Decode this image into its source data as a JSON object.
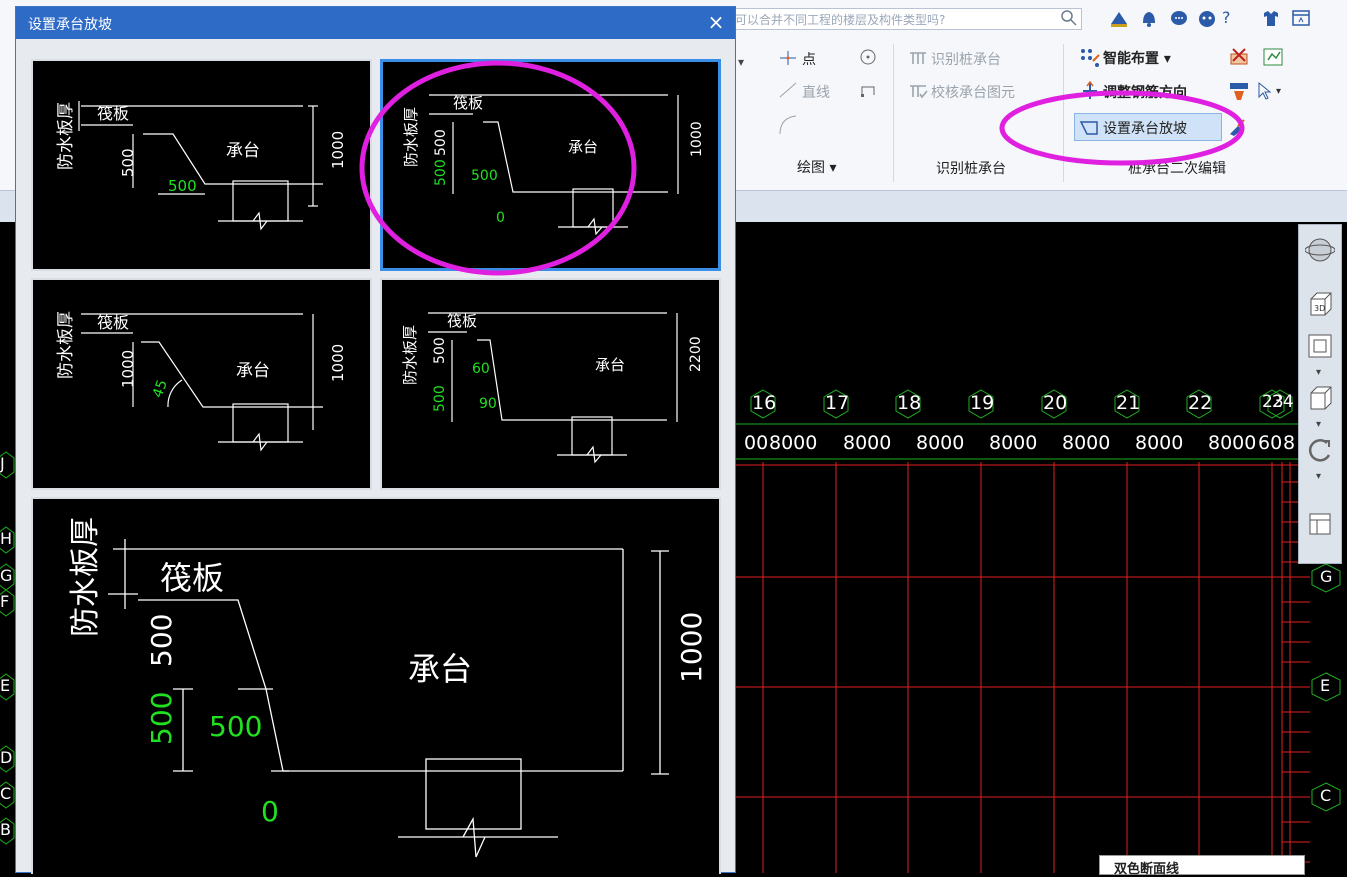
{
  "dialog": {
    "title": "设置承台放坡",
    "close_glyph": "×"
  },
  "search": {
    "text": "可以合并不同工程的楼层及构件类型吗?"
  },
  "ribbon": {
    "draw": {
      "point": "点",
      "line": "直线",
      "group_label": "绘图"
    },
    "identify": {
      "identify_pile_cap": "识别桩承台",
      "verify_pile_cap": "校核承台图元",
      "group_label": "识别桩承台"
    },
    "edit": {
      "smart_layout": "智能布置",
      "adjust_rebar_direction": "调整钢筋方向",
      "set_slope": "设置承台放坡",
      "group_label": "桩承台二次编辑"
    },
    "question": "?"
  },
  "diagrams": {
    "raft": "筏板",
    "cap": "承台",
    "waterproof": "防水板厚",
    "d1": {
      "dim_left": "500",
      "dim_bottom": "500",
      "dim_right": "1000"
    },
    "d2": {
      "dim_left_top": "500",
      "dim_left_bottom": "500",
      "dim_mid": "500",
      "dim_zero": "0",
      "dim_right": "1000"
    },
    "d3": {
      "dim_left": "1000",
      "angle": "45",
      "dim_right": "1000"
    },
    "d4": {
      "dim_left_top": "500",
      "dim_left_bottom": "500",
      "angle_top": "60",
      "angle_bottom": "90",
      "dim_right": "2200"
    },
    "large": {
      "dim_left_top": "500",
      "dim_left_bottom": "500",
      "dim_mid": "500",
      "dim_zero": "0",
      "dim_right": "1000"
    }
  },
  "grid": {
    "columns": [
      "16",
      "17",
      "18",
      "19",
      "20",
      "21",
      "22",
      "23",
      "24"
    ],
    "spacings": [
      "8000",
      "8000",
      "8000",
      "8000",
      "8000",
      "8000",
      "8000",
      "8000"
    ],
    "partial_left": "00",
    "left_rows": [
      "J",
      "H",
      "G",
      "F",
      "E",
      "D",
      "C",
      "B"
    ],
    "right_rows": [
      "G",
      "E",
      "C"
    ],
    "edge_spacing": "60",
    "edge_spacing_2": "8"
  },
  "popup": {
    "text": "双色断面线"
  },
  "colors": {
    "accent": "#2e6bc6",
    "annotation": "#e020e0",
    "grid_red": "#e02020",
    "grid_green": "#20b020",
    "dim_green": "#20e020"
  },
  "icons": [
    "search-icon",
    "user-icon",
    "bell-icon",
    "chat-icon",
    "face-icon",
    "shirt-icon",
    "window-icon",
    "circle-icon",
    "rect-icon",
    "smart-layout-icon",
    "rebar-direction-icon",
    "slope-icon",
    "cube-3d-icon",
    "sphere-icon"
  ]
}
